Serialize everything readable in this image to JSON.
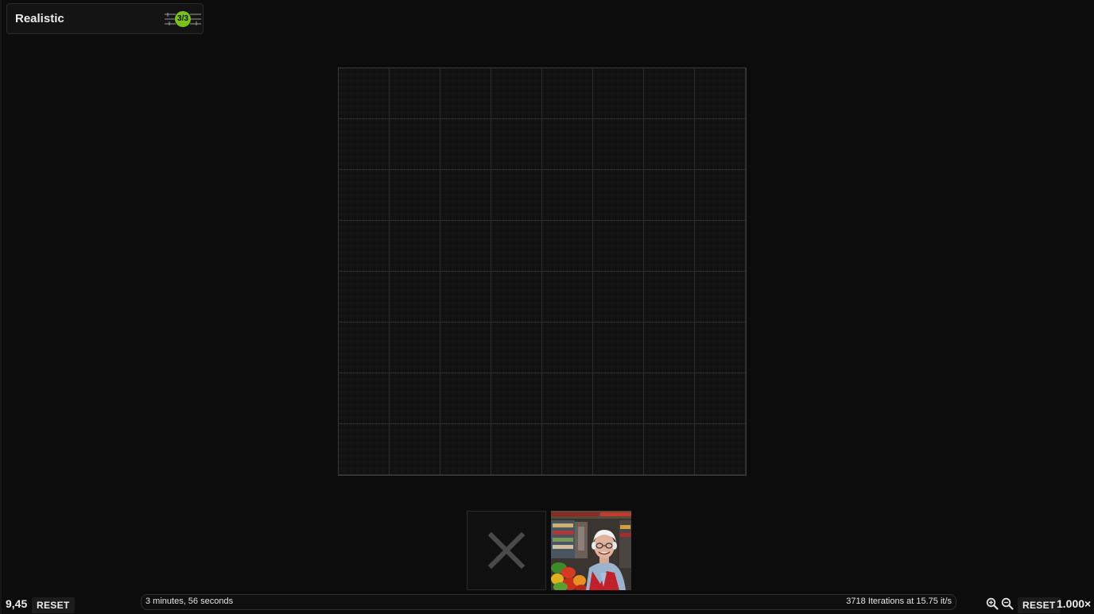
{
  "workflow": {
    "title": "Realistic",
    "badge": "3/3",
    "icon": "workflow-steps-icon",
    "accent_color": "#7ac21a"
  },
  "canvas": {
    "grid_cells": 8
  },
  "thumbnails": [
    {
      "type": "empty",
      "icon": "close-icon"
    },
    {
      "type": "image",
      "description_icon": "generated-image"
    }
  ],
  "footer": {
    "position_value": "9,45",
    "reset_left_label": "RESET",
    "elapsed": "3 minutes, 56 seconds",
    "iterations": "3718 Iterations at 15.75 it/s",
    "zoom_in_icon": "zoom-in-icon",
    "zoom_out_icon": "zoom-out-icon",
    "reset_right_label": "RESET",
    "zoom_level": "1.000×"
  }
}
